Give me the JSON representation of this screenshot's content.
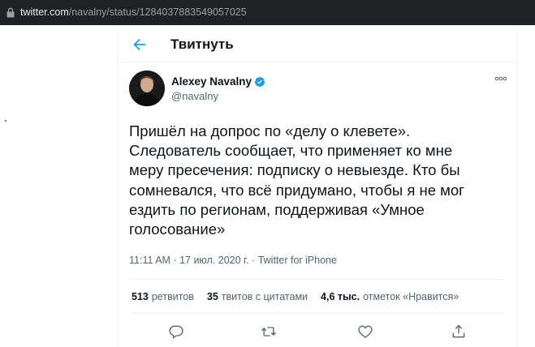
{
  "browser": {
    "url_host": "twitter.com",
    "url_path": "/navalny/status/1284037883549057025",
    "icons": {
      "lock": "lock-icon"
    }
  },
  "header": {
    "title": "Твитнуть",
    "back_icon": "back-arrow-icon"
  },
  "tweet": {
    "author_name": "Alexey Navalny",
    "author_handle": "@navalny",
    "verified": true,
    "text": "Пришёл на допрос по «делу о клевете».\nСледователь сообщает, что применяет ко мне\nмеру пресечения: подписку о невыезде. Кто бы\nсомневался, что всё придумано, чтобы я не мог\nездить по регионам, поддерживая «Умное\nголосование»",
    "time": "11:11 AM",
    "date": "17 июл. 2020 г.",
    "separator": " · ",
    "source": "Twitter for iPhone"
  },
  "stats": {
    "retweets_count": "513",
    "retweets_label": "ретвитов",
    "quotes_count": "35",
    "quotes_label": "твитов с цитатами",
    "likes_count": "4,6 тыс.",
    "likes_label": "отметок «Нравится»"
  },
  "actions": {
    "icons": [
      "reply-icon",
      "retweet-icon",
      "like-icon",
      "share-icon"
    ]
  },
  "colors": {
    "text": "#0f1419",
    "secondary": "#536471",
    "accent": "#1d9bf0",
    "divider": "#eff3f4",
    "addressbar": "#202124"
  }
}
